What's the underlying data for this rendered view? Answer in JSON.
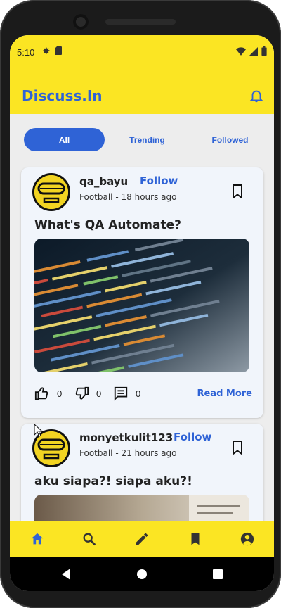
{
  "status_bar": {
    "time": "5:10"
  },
  "app": {
    "title": "Discuss.In"
  },
  "tabs": [
    {
      "label": "All",
      "active": true
    },
    {
      "label": "Trending",
      "active": false
    },
    {
      "label": "Followed",
      "active": false
    }
  ],
  "posts": [
    {
      "username": "qa_bayu",
      "follow_label": "Follow",
      "category": "Football",
      "separator": "-",
      "time_ago": "18 hours ago",
      "title": "What's QA Automate?",
      "likes": "0",
      "dislikes": "0",
      "comments": "0",
      "read_more": "Read More"
    },
    {
      "username": "monyetkulit123",
      "follow_label": "Follow",
      "category": "Football",
      "separator": "-",
      "time_ago": "21 hours ago",
      "title": "aku siapa?! siapa aku?!"
    }
  ],
  "colors": {
    "accent": "#2f63d6",
    "bar_yellow": "#fbe523",
    "background": "#ededed",
    "card": "#f1f5fb"
  },
  "bottom_nav": [
    "home-icon",
    "search-icon",
    "pencil-icon",
    "bookmark-icon",
    "account-icon"
  ]
}
